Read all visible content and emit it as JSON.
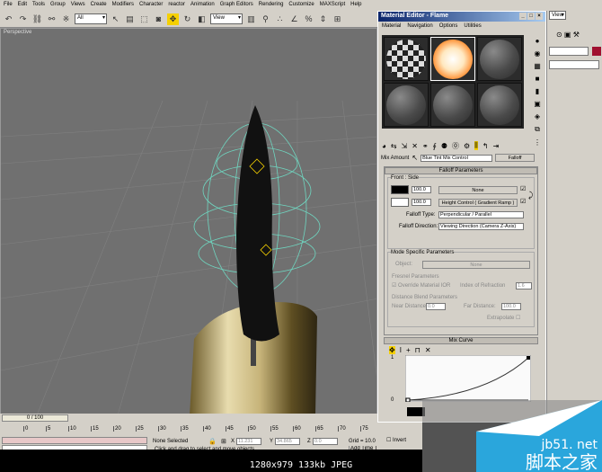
{
  "menu": [
    "File",
    "Edit",
    "Tools",
    "Group",
    "Views",
    "Create",
    "Modifiers",
    "Character",
    "reactor",
    "Animation",
    "Graph Editors",
    "Rendering",
    "Customize",
    "MAXScript",
    "Help"
  ],
  "toolbar": {
    "selection_filter": "All",
    "ref_coord": "View",
    "cmd_view": "View"
  },
  "viewport": {
    "label": "Perspective"
  },
  "material_editor": {
    "title": "Material Editor - Flame",
    "menu": [
      "Material",
      "Navigation",
      "Options",
      "Utilities"
    ],
    "mix_amount_label": "Mix Amount",
    "material_name": "Blue Tint Mix Control",
    "map_type": "Falloff",
    "falloff_params": {
      "title": "Falloff Parameters",
      "front_side_label": "Front : Side",
      "front_value": "100.0",
      "front_map": "None",
      "side_value": "100.0",
      "side_map": "Height Control  ( Gradient Ramp )",
      "falloff_type_label": "Falloff Type:",
      "falloff_type": "Perpendicular / Parallel",
      "falloff_direction_label": "Falloff Direction:",
      "falloff_direction": "Viewing Direction (Camera Z-Axis)"
    },
    "mode_specific": {
      "title": "Mode Specific Parameters",
      "object_label": "Object:",
      "object_value": "None",
      "fresnel_title": "Fresnel Parameters",
      "override_ior": "Override Material IOR",
      "ior_label": "Index of Refraction",
      "ior_value": "1.6",
      "distance_title": "Distance Blend Parameters",
      "near_label": "Near Distance:",
      "near_value": "0.0",
      "far_label": "Far Distance:",
      "far_value": "100.0",
      "extrapolate": "Extrapolate"
    },
    "mix_curve": {
      "title": "Mix Curve",
      "y_max": "1",
      "y_min": "0"
    }
  },
  "timeline": {
    "frame": "0 / 100",
    "ticks": [
      "0",
      "5",
      "10",
      "15",
      "20",
      "25",
      "30",
      "35",
      "40",
      "45",
      "50",
      "55",
      "60",
      "65",
      "70",
      "75"
    ]
  },
  "status": {
    "selection": "None Selected",
    "x_label": "X",
    "x": "11.231",
    "y_label": "Y",
    "y": "34.865",
    "z_label": "Z",
    "z": "0.0",
    "grid": "Grid = 10.0",
    "prompt": "Click and drag to select and move objects",
    "add_time_tag": "Add Time T",
    "invert": "Invert"
  },
  "caption": "1280x979 133kb JPEG",
  "watermark": {
    "site": "jb51.net",
    "name": "脚本之家"
  },
  "colors": {
    "accent_yellow": "#f5d000",
    "title_blue": "#0a246a",
    "watermark_blue": "#2aa6dc"
  }
}
